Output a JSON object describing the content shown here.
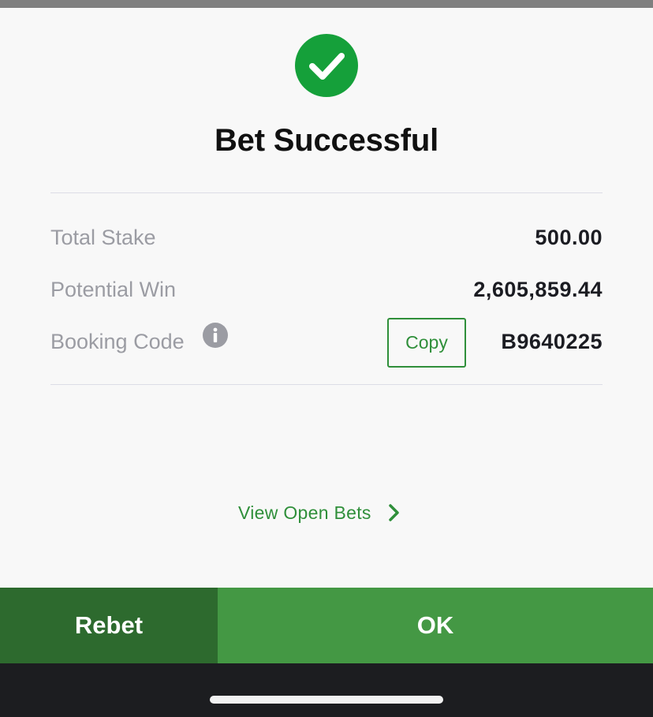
{
  "dialog": {
    "title": "Bet Successful",
    "status_icon": "check-circle-icon",
    "accent_color": "#15a03a"
  },
  "summary": {
    "total_stake_label": "Total Stake",
    "total_stake_value": "500.00",
    "potential_win_label": "Potential Win",
    "potential_win_value": "2,605,859.44",
    "booking_code_label": "Booking Code",
    "booking_code_icon": "info-icon",
    "booking_code_value": "B9640225",
    "copy_label": "Copy"
  },
  "links": {
    "view_open_bets": "View Open Bets",
    "chevron_icon": "chevron-right-icon"
  },
  "actions": {
    "rebet_label": "Rebet",
    "ok_label": "OK",
    "rebet_color": "#2d6a2e",
    "ok_color": "#449844"
  }
}
